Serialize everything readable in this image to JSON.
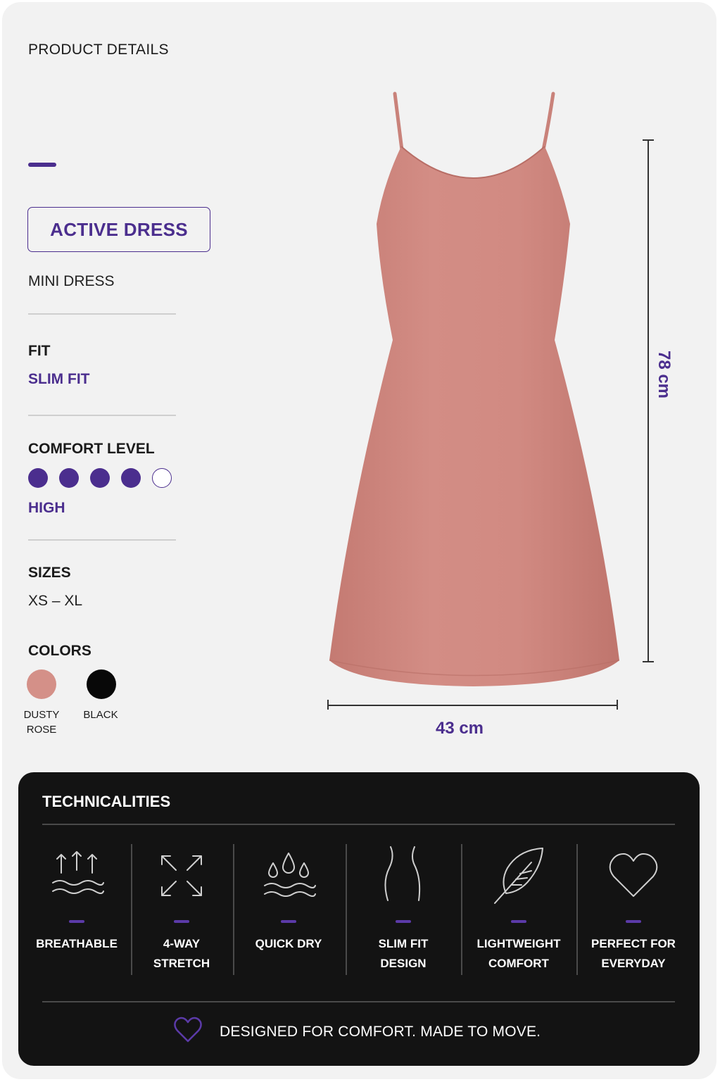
{
  "header": {
    "title": "PRODUCT DETAILS"
  },
  "product": {
    "name": "ACTIVE DRESS",
    "type": "MINI DRESS"
  },
  "fit": {
    "label": "FIT",
    "value": "SLIM FIT"
  },
  "comfort": {
    "label": "COMFORT LEVEL",
    "rating": 4,
    "max": 5,
    "value": "HIGH"
  },
  "sizes": {
    "label": "SIZES",
    "value": "XS – XL"
  },
  "colors": {
    "label": "COLORS",
    "options": [
      {
        "name_line1": "DUSTY",
        "name_line2": "ROSE",
        "hex": "#d49088"
      },
      {
        "name_line1": "BLACK",
        "name_line2": "",
        "hex": "#080808"
      }
    ]
  },
  "dimensions": {
    "height": "78 cm",
    "width": "43 cm"
  },
  "technicalities": {
    "title": "TECHNICALITIES",
    "features": [
      {
        "line1": "BREATHABLE",
        "line2": "",
        "icon": "breathable-icon"
      },
      {
        "line1": "4-WAY",
        "line2": "STRETCH",
        "icon": "stretch-icon"
      },
      {
        "line1": "QUICK DRY",
        "line2": "",
        "icon": "quick-dry-icon"
      },
      {
        "line1": "SLIM FIT",
        "line2": "DESIGN",
        "icon": "slim-fit-icon"
      },
      {
        "line1": "LIGHTWEIGHT",
        "line2": "COMFORT",
        "icon": "feather-icon"
      },
      {
        "line1": "PERFECT FOR",
        "line2": "EVERYDAY",
        "icon": "heart-icon"
      }
    ],
    "tagline": "DESIGNED FOR COMFORT. MADE TO MOVE."
  },
  "colors_theme": {
    "accent": "#4b2e8e",
    "dress": "#d08a82",
    "panel": "#131313",
    "background": "#f2f2f2"
  }
}
